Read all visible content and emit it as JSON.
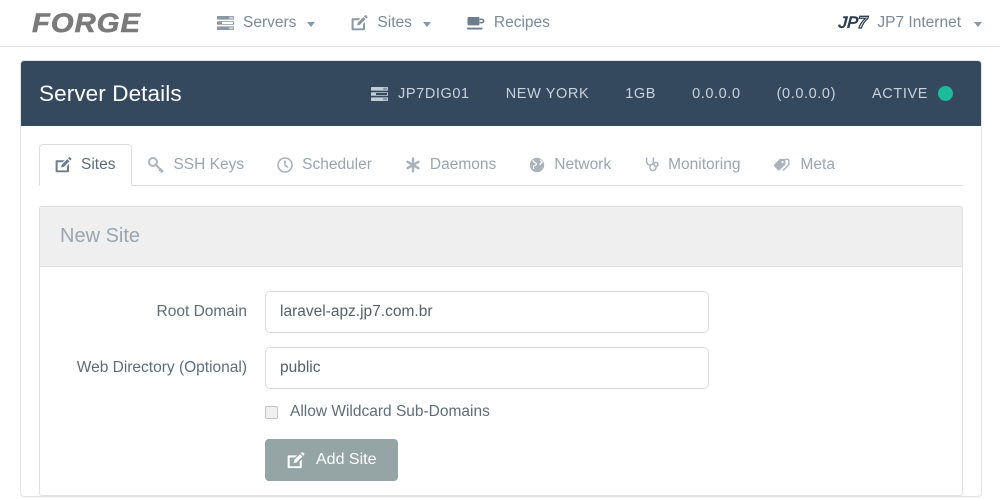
{
  "navbar": {
    "brand": "FORGE",
    "items": [
      {
        "label": "Servers",
        "icon": "server-stack-icon",
        "caret": true
      },
      {
        "label": "Sites",
        "icon": "pencil-square-icon",
        "caret": true
      },
      {
        "label": "Recipes",
        "icon": "coffee-cup-icon",
        "caret": false
      }
    ],
    "account": {
      "logo_main": "JP",
      "logo_outline": "7",
      "name": "JP7 Internet"
    }
  },
  "panel": {
    "title": "Server Details",
    "server": {
      "icon": "server-stack-icon",
      "name": "JP7DIG01",
      "region": "NEW YORK",
      "memory": "1GB",
      "ip": "0.0.0.0",
      "private_ip": "(0.0.0.0)",
      "status": "ACTIVE",
      "status_color": "#1abc9c"
    }
  },
  "tabs": [
    {
      "label": "Sites",
      "icon": "pencil-square-icon",
      "active": true
    },
    {
      "label": "SSH Keys",
      "icon": "key-icon",
      "active": false
    },
    {
      "label": "Scheduler",
      "icon": "clock-icon",
      "active": false
    },
    {
      "label": "Daemons",
      "icon": "asterisk-icon",
      "active": false
    },
    {
      "label": "Network",
      "icon": "globe-icon",
      "active": false
    },
    {
      "label": "Monitoring",
      "icon": "stethoscope-icon",
      "active": false
    },
    {
      "label": "Meta",
      "icon": "tag-icon",
      "active": false
    }
  ],
  "new_site": {
    "heading": "New Site",
    "root_domain": {
      "label": "Root Domain",
      "value": "laravel-apz.jp7.com.br",
      "placeholder": ""
    },
    "web_directory": {
      "label": "Web Directory (Optional)",
      "value": "public",
      "placeholder": ""
    },
    "wildcard": {
      "label": "Allow Wildcard Sub-Domains",
      "checked": false
    },
    "submit": {
      "label": "Add Site",
      "icon": "pencil-square-icon",
      "color": "#95a5a6"
    }
  }
}
